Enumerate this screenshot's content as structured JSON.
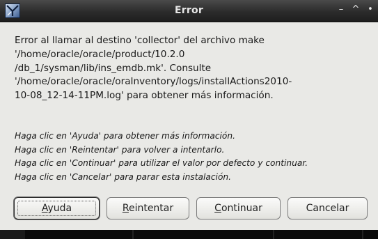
{
  "window": {
    "title": "Error",
    "controls": {
      "minimize": "–",
      "maximize": "^",
      "close": "•"
    }
  },
  "message": {
    "lines": [
      "Error al llamar al destino 'collector' del archivo make",
      "'/home/oracle/oracle/product/10.2.0",
      "/db_1/sysman/lib/ins_emdb.mk'. Consulte",
      "'/home/oracle/oracle/oraInventory/logs/installActions2010-",
      "10-08_12-14-11PM.log' para obtener más información."
    ]
  },
  "hints": [
    "Haga clic en 'Ayuda' para obtener más información.",
    "Haga clic en 'Reintentar' para volver a intentarlo.",
    "Haga clic en 'Continuar' para utilizar el valor por defecto y continuar.",
    "Haga clic en 'Cancelar' para parar esta instalación."
  ],
  "buttons": {
    "ayuda": {
      "mnemonic": "A",
      "rest": "yuda"
    },
    "reintentar": {
      "mnemonic": "R",
      "rest": "eintentar"
    },
    "continuar": {
      "mnemonic": "C",
      "rest": "ontinuar"
    },
    "cancelar": {
      "label": "Cancelar"
    }
  }
}
